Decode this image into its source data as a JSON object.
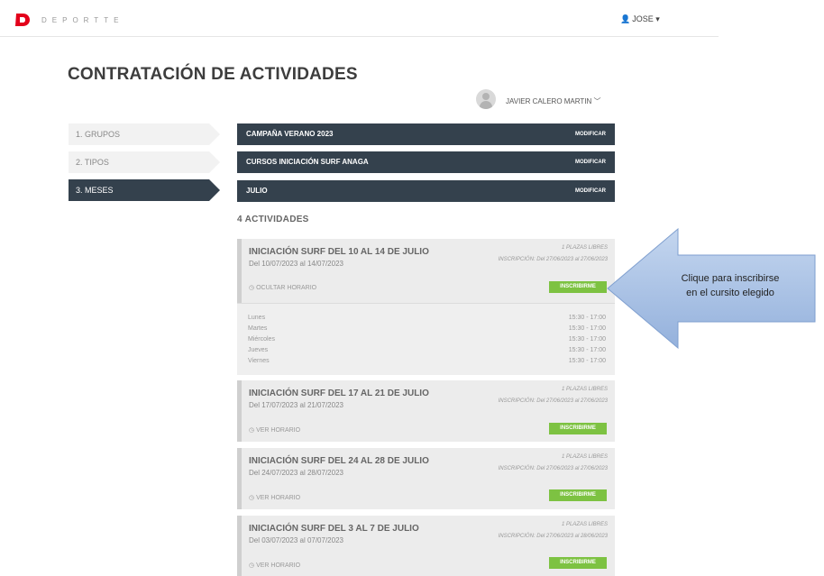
{
  "header": {
    "brand": "DEPORTTE",
    "user": "JOSE",
    "user_icon": "user-icon",
    "caret": "▾"
  },
  "page": {
    "title": "CONTRATACIÓN DE ACTIVIDADES"
  },
  "profile": {
    "name": "JAVIER CALERO MARTIN",
    "chevron": "⌵"
  },
  "steps": [
    {
      "label": "1. GRUPOS",
      "active": false
    },
    {
      "label": "2. TIPOS",
      "active": false
    },
    {
      "label": "3. MESES",
      "active": true
    }
  ],
  "selections": [
    {
      "label": "CAMPAÑA VERANO 2023",
      "action": "MODIFICAR"
    },
    {
      "label": "CURSOS INICIACIÓN SURF ANAGA",
      "action": "MODIFICAR"
    },
    {
      "label": "JULIO",
      "action": "MODIFICAR"
    }
  ],
  "activities_count": "4 ACTIVIDADES",
  "activities": [
    {
      "title": "INICIACIÓN SURF DEL 10 AL 14 DE JULIO",
      "dates": "Del 10/07/2023 al 14/07/2023",
      "plazas": "1 PLAZAS LIBRES",
      "inscripcion": "INSCRIPCIÓN: Del 27/06/2023 al 27/06/2023",
      "horario_toggle": "OCULTAR HORARIO",
      "button": "INSCRIBIRME"
    },
    {
      "title": "INICIACIÓN SURF DEL 17 AL 21 DE JULIO",
      "dates": "Del 17/07/2023 al 21/07/2023",
      "plazas": "1 PLAZAS LIBRES",
      "inscripcion": "INSCRIPCIÓN: Del 27/06/2023 al 27/06/2023",
      "horario_toggle": "VER HORARIO",
      "button": "INSCRIBIRME"
    },
    {
      "title": "INICIACIÓN SURF DEL 24 AL 28 DE JULIO",
      "dates": "Del 24/07/2023 al 28/07/2023",
      "plazas": "1 PLAZAS LIBRES",
      "inscripcion": "INSCRIPCIÓN: Del 27/06/2023 al 27/06/2023",
      "horario_toggle": "VER HORARIO",
      "button": "INSCRIBIRME"
    },
    {
      "title": "INICIACIÓN SURF DEL 3 AL 7 DE JULIO",
      "dates": "Del 03/07/2023 al 07/07/2023",
      "plazas": "1 PLAZAS LIBRES",
      "inscripcion": "INSCRIPCIÓN: Del 27/06/2023 al 28/06/2023",
      "horario_toggle": "VER HORARIO",
      "button": "INSCRIBIRME"
    }
  ],
  "schedule": [
    {
      "day": "Lunes",
      "time": "15:30 - 17:00"
    },
    {
      "day": "Martes",
      "time": "15:30 - 17:00"
    },
    {
      "day": "Miércoles",
      "time": "15:30 - 17:00"
    },
    {
      "day": "Jueves",
      "time": "15:30 - 17:00"
    },
    {
      "day": "Viernes",
      "time": "15:30 - 17:00"
    }
  ],
  "callout": {
    "line1": "Clique para inscribirse",
    "line2": "en el cursito elegido"
  },
  "colors": {
    "dark": "#34414d",
    "green": "#7dc242",
    "brand_red": "#e3001b",
    "callout_blue": "#a9c3e6"
  }
}
